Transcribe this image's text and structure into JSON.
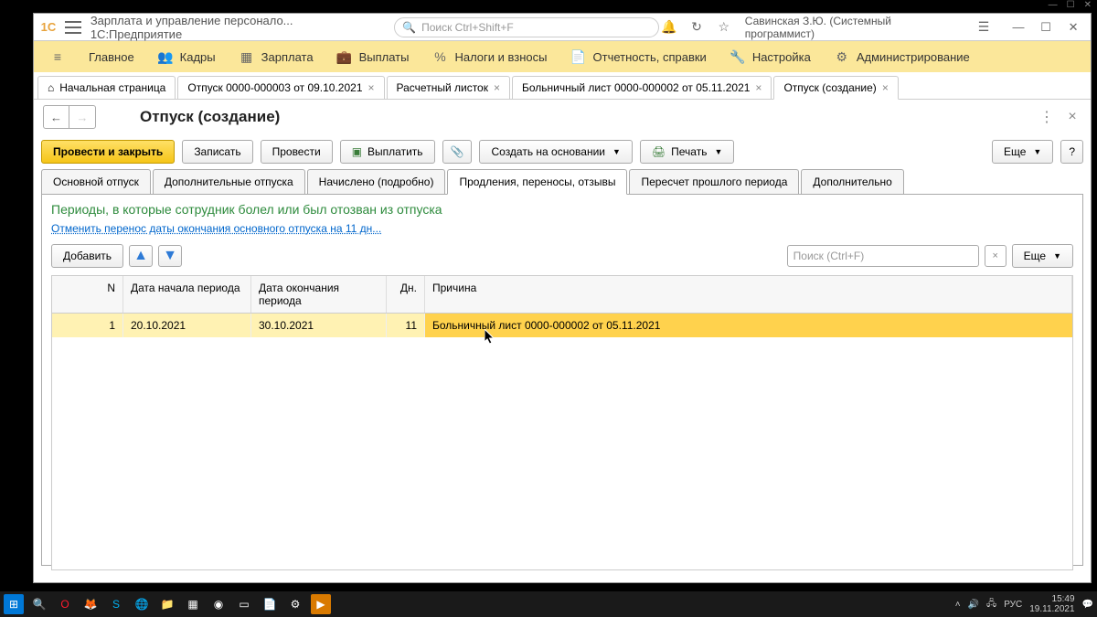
{
  "titlebar": {
    "app_label": "Зарплата и управление персонало...   1С:Предприятие",
    "search_placeholder": "Поиск Ctrl+Shift+F",
    "user": "Савинская З.Ю. (Системный программист)"
  },
  "mainnav": [
    {
      "label": "Главное"
    },
    {
      "label": "Кадры"
    },
    {
      "label": "Зарплата"
    },
    {
      "label": "Выплаты"
    },
    {
      "label": "Налоги и взносы"
    },
    {
      "label": "Отчетность, справки"
    },
    {
      "label": "Настройка"
    },
    {
      "label": "Администрирование"
    }
  ],
  "tabs": [
    {
      "label": "Начальная страница",
      "home": true
    },
    {
      "label": "Отпуск 0000-000003 от 09.10.2021"
    },
    {
      "label": "Расчетный листок"
    },
    {
      "label": "Больничный лист 0000-000002 от 05.11.2021"
    },
    {
      "label": "Отпуск (создание)",
      "active": true
    }
  ],
  "page": {
    "title": "Отпуск (создание)",
    "post_close": "Провести и закрыть",
    "save": "Записать",
    "post": "Провести",
    "pay": "Выплатить",
    "create_based": "Создать на основании",
    "print": "Печать",
    "more": "Еще",
    "help": "?"
  },
  "innertabs": [
    "Основной отпуск",
    "Дополнительные отпуска",
    "Начислено (подробно)",
    "Продления, переносы, отзывы",
    "Пересчет прошлого периода",
    "Дополнительно"
  ],
  "section": {
    "title": "Периоды, в которые сотрудник болел или был отозван из отпуска",
    "link": "Отменить перенос даты окончания основного отпуска на 11 дн...",
    "add": "Добавить",
    "search_placeholder": "Поиск (Ctrl+F)",
    "more": "Еще"
  },
  "table": {
    "headers": {
      "n": "N",
      "start": "Дата начала периода",
      "end": "Дата окончания периода",
      "days": "Дн.",
      "reason": "Причина"
    },
    "rows": [
      {
        "n": "1",
        "start": "20.10.2021",
        "end": "30.10.2021",
        "days": "11",
        "reason": "Больничный лист 0000-000002 от 05.11.2021"
      }
    ]
  },
  "tray": {
    "time": "15:49",
    "date": "19.11.2021",
    "lang": "РУС"
  }
}
